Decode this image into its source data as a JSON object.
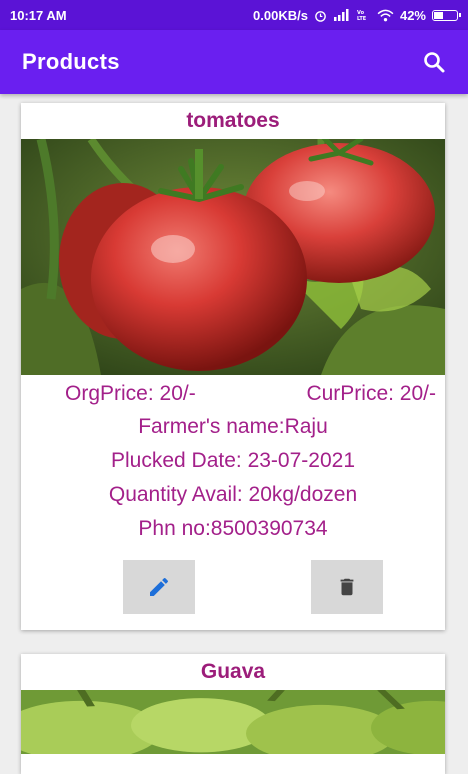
{
  "status_bar": {
    "time": "10:17 AM",
    "network_speed": "0.00KB/s",
    "battery": "42%"
  },
  "app_bar": {
    "title": "Products",
    "search_icon": "search-icon"
  },
  "products": [
    {
      "name": "tomatoes",
      "org_price": "OrgPrice: 20/-",
      "cur_price": "CurPrice: 20/-",
      "farmer": "Farmer's name:Raju",
      "plucked_date": "Plucked Date: 23-07-2021",
      "quantity": "Quantity Avail: 20kg/dozen",
      "phone": "Phn no:8500390734",
      "actions": {
        "edit_icon": "pencil-icon",
        "delete_icon": "trash-icon"
      }
    },
    {
      "name": "Guava"
    }
  ],
  "colors": {
    "status_bar": "#5b13d6",
    "app_bar": "#6a1ff0",
    "text_accent": "#a3208a",
    "edit_icon": "#1e6fd9",
    "delete_icon": "#444444"
  }
}
